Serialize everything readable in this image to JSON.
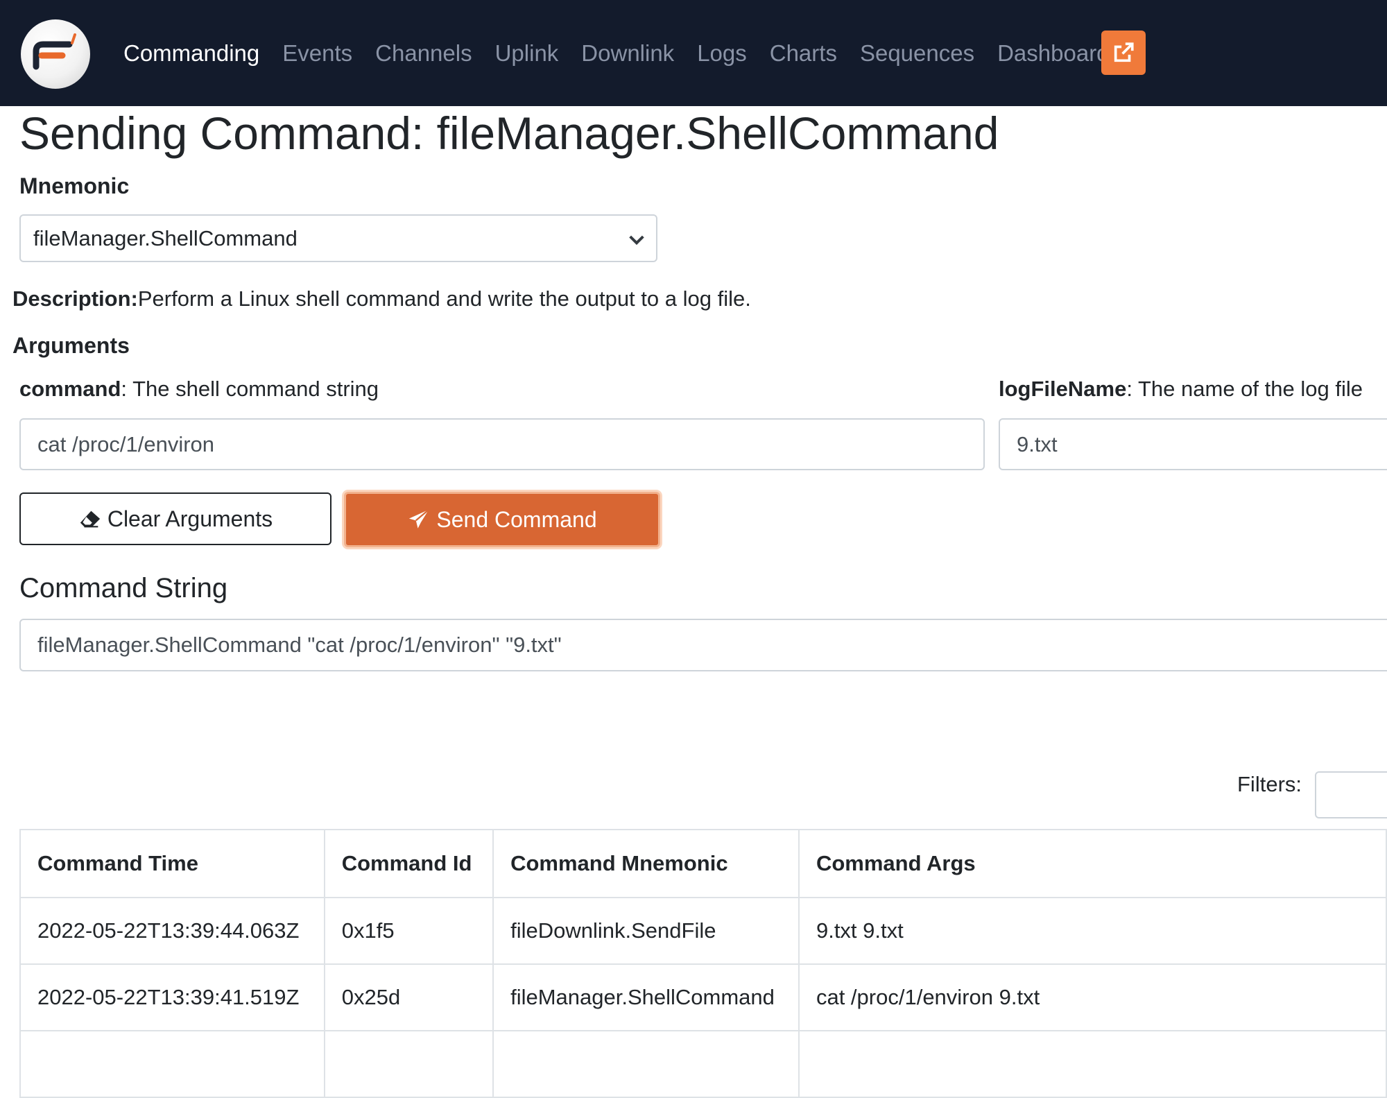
{
  "nav": {
    "items": [
      {
        "label": "Commanding",
        "active": true
      },
      {
        "label": "Events",
        "active": false
      },
      {
        "label": "Channels",
        "active": false
      },
      {
        "label": "Uplink",
        "active": false
      },
      {
        "label": "Downlink",
        "active": false
      },
      {
        "label": "Logs",
        "active": false
      },
      {
        "label": "Charts",
        "active": false
      },
      {
        "label": "Sequences",
        "active": false
      },
      {
        "label": "Dashboard",
        "active": false
      }
    ],
    "external_icon": "external-link-icon",
    "accent_color": "#f07a3a",
    "background_color": "#131b2c"
  },
  "page": {
    "title": "Sending Command: fileManager.ShellCommand"
  },
  "mnemonic": {
    "label": "Mnemonic",
    "selected": "fileManager.ShellCommand"
  },
  "description": {
    "label": "Description:",
    "text": "Perform a Linux shell command and write the output to a log file."
  },
  "arguments": {
    "heading": "Arguments",
    "items": [
      {
        "name": "command",
        "desc": ": The shell command string",
        "value": "cat /proc/1/environ"
      },
      {
        "name": "logFileName",
        "desc": ": The name of the log file",
        "value": "9.txt"
      }
    ]
  },
  "buttons": {
    "clear": "Clear Arguments",
    "send": "Send Command",
    "send_color": "#d86633"
  },
  "command_string": {
    "title": "Command String",
    "value": "fileManager.ShellCommand \"cat /proc/1/environ\" \"9.txt\""
  },
  "filters": {
    "label": "Filters:",
    "value": ""
  },
  "table": {
    "headers": [
      "Command Time",
      "Command Id",
      "Command Mnemonic",
      "Command Args"
    ],
    "rows": [
      [
        "2022-05-22T13:39:44.063Z",
        "0x1f5",
        "fileDownlink.SendFile",
        "9.txt 9.txt"
      ],
      [
        "2022-05-22T13:39:41.519Z",
        "0x25d",
        "fileManager.ShellCommand",
        "cat /proc/1/environ 9.txt"
      ]
    ]
  }
}
